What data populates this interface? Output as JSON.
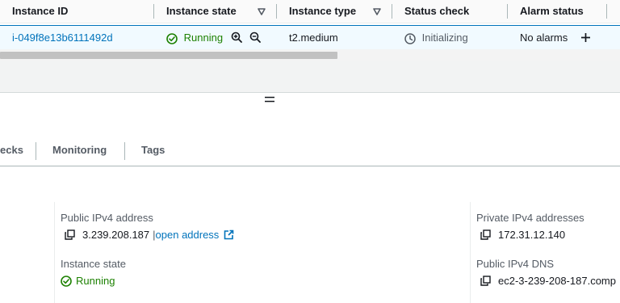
{
  "table": {
    "columns": [
      {
        "label": "Instance ID",
        "sortable": false
      },
      {
        "label": "Instance state",
        "sortable": true
      },
      {
        "label": "Instance type",
        "sortable": true
      },
      {
        "label": "Status check",
        "sortable": false
      },
      {
        "label": "Alarm status",
        "sortable": false
      }
    ],
    "row": {
      "instance_id": "i-049f8e13b6111492d",
      "state": "Running",
      "type": "t2.medium",
      "status_check": "Initializing",
      "alarm_status": "No alarms"
    }
  },
  "tabs": [
    "ecks",
    "Monitoring",
    "Tags"
  ],
  "details": {
    "public_ipv4_label": "Public IPv4 address",
    "public_ipv4_value": "3.239.208.187",
    "open_address_label": "open address",
    "instance_state_label": "Instance state",
    "instance_state_value": "Running",
    "private_ipv4_label": "Private IPv4 addresses",
    "private_ipv4_value": "172.31.12.140",
    "public_dns_label": "Public IPv4 DNS",
    "public_dns_value": "ec2-3-239-208-187.comp"
  },
  "colors": {
    "link": "#0073bb",
    "success": "#1d8102",
    "selected_row_bg": "#f1faff",
    "header_bg": "#fafafa"
  }
}
